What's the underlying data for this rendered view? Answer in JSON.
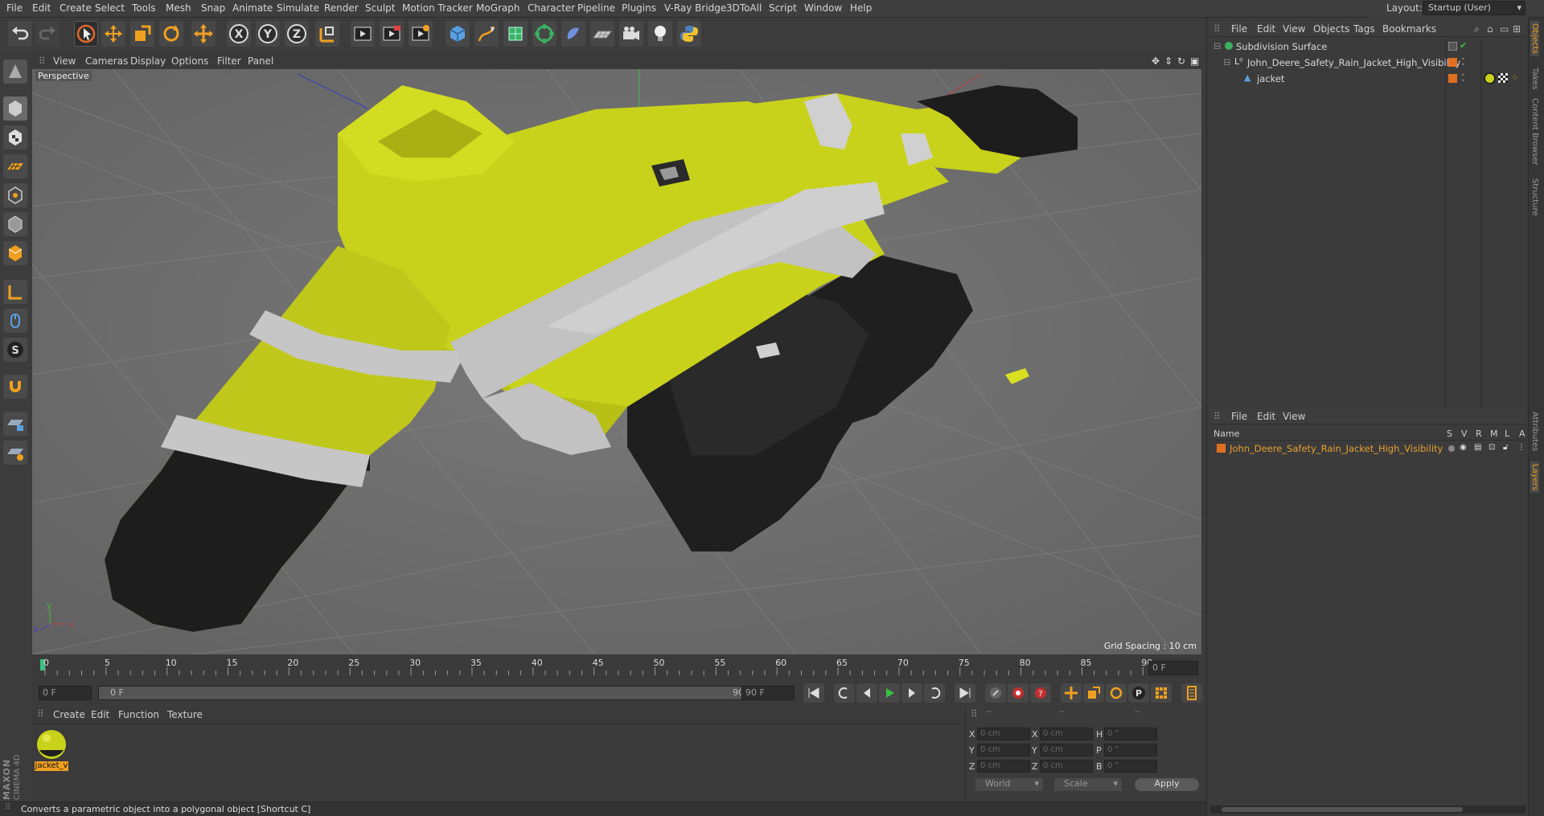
{
  "menu": [
    "File",
    "Edit",
    "Create",
    "Select",
    "Tools",
    "Mesh",
    "Snap",
    "Animate",
    "Simulate",
    "Render",
    "Sculpt",
    "Motion Tracker",
    "MoGraph",
    "Character",
    "Pipeline",
    "Plugins",
    "V-Ray Bridge",
    "3DToAll",
    "Script",
    "Window",
    "Help"
  ],
  "layout": {
    "label": "Layout:",
    "value": "Startup (User)"
  },
  "toolbar_icons": [
    "undo-icon",
    "redo-icon",
    "select-arrow-icon",
    "move-icon",
    "scale-icon",
    "rotate-icon",
    "move-all-icon",
    "x-axis-icon",
    "y-axis-icon",
    "z-axis-icon",
    "coordinate-system-icon",
    "render-view-icon",
    "render-picture-viewer-icon",
    "render-settings-icon",
    "cube-icon",
    "pen-spline-icon",
    "subdivision-icon",
    "array-icon",
    "deformer-icon",
    "floor-icon",
    "camera-icon",
    "light-icon",
    "python-icon"
  ],
  "axis_letters": {
    "x": "X",
    "y": "Y",
    "z": "Z"
  },
  "viewport": {
    "menu": [
      "View",
      "Cameras",
      "Display",
      "Options",
      "Filter",
      "Panel"
    ],
    "label": "Perspective",
    "grid_spacing": "Grid Spacing : 10 cm",
    "axes": {
      "x": "x",
      "y": "y",
      "z": "z"
    }
  },
  "timeline": {
    "ticks": [
      "0",
      "5",
      "10",
      "15",
      "20",
      "25",
      "30",
      "35",
      "40",
      "45",
      "50",
      "55",
      "60",
      "65",
      "70",
      "75",
      "80",
      "85",
      "90"
    ],
    "current_frame": "0 F"
  },
  "transport": {
    "start": "0 F",
    "range_start": "0 F",
    "range_end": "90 F",
    "end": "90 F"
  },
  "material_manager": {
    "menu": [
      "Create",
      "Edit",
      "Function",
      "Texture"
    ],
    "material_name": "jacket_v"
  },
  "coordinates": {
    "header": [
      "--",
      "--",
      "--"
    ],
    "rows": [
      {
        "a": "X",
        "av": "0 cm",
        "b": "X",
        "bv": "0 cm",
        "c": "H",
        "cv": "0 °"
      },
      {
        "a": "Y",
        "av": "0 cm",
        "b": "Y",
        "bv": "0 cm",
        "c": "P",
        "cv": "0 °"
      },
      {
        "a": "Z",
        "av": "0 cm",
        "b": "Z",
        "bv": "0 cm",
        "c": "B",
        "cv": "0 °"
      }
    ],
    "mode": "World",
    "type": "Scale",
    "apply": "Apply"
  },
  "status": "Converts a parametric object into a polygonal object [Shortcut C]",
  "brand": {
    "line1": "MAXON",
    "line2": "CINEMA 4D"
  },
  "object_manager": {
    "menu": [
      "File",
      "Edit",
      "View",
      "Objects",
      "Tags",
      "Bookmarks"
    ],
    "objects": [
      {
        "name": "Subdivision Surface",
        "level": 0
      },
      {
        "name": "John_Deere_Safety_Rain_Jacket_High_Visibility",
        "level": 1
      },
      {
        "name": "jacket",
        "level": 2
      }
    ]
  },
  "layer_manager": {
    "menu": [
      "File",
      "Edit",
      "View"
    ],
    "columns": {
      "name": "Name",
      "flags": [
        "S",
        "V",
        "R",
        "M",
        "L",
        "A"
      ]
    },
    "layers": [
      {
        "name": "John_Deere_Safety_Rain_Jacket_High_Visibility",
        "color": "#e07020"
      }
    ]
  },
  "side_tabs": [
    "Objects",
    "Takes",
    "Content Browser",
    "Structure",
    "Attributes",
    "Layers"
  ],
  "colors": {
    "accent": "#f0a020",
    "jacket_yellow": "#c8d21a",
    "layer_text": "#e8a030"
  }
}
